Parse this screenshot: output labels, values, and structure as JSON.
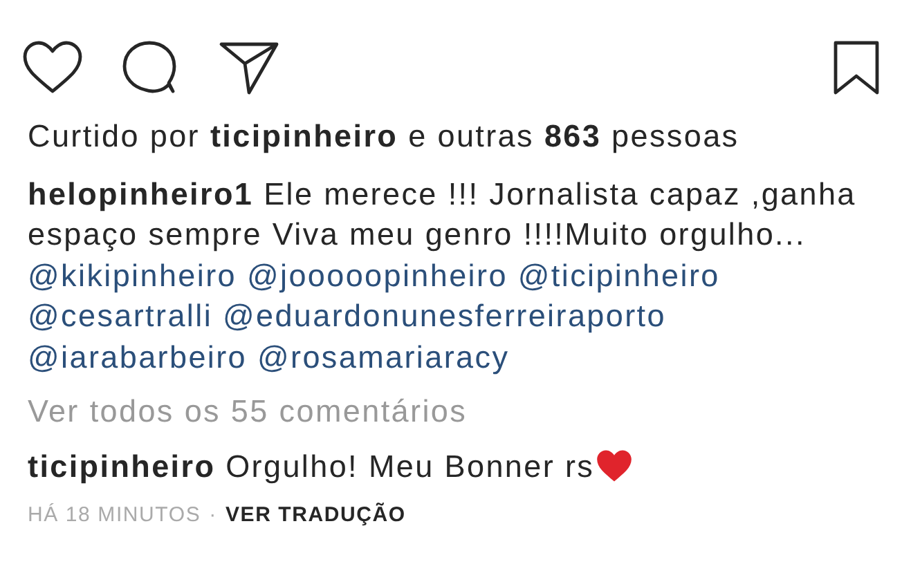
{
  "likes": {
    "text": "Curtido por **ticipinheiro** e outras **863** pessoas"
  },
  "caption": {
    "username": "helopinheiro1",
    "text": "Ele merece !!! Jornalista capaz ,ganha espaço sempre Viva meu genro !!!!Muito orgulho...",
    "mentions": [
      "@kikipinheiro",
      "@jooooopinheiro",
      "@ticipinheiro",
      "@cesartralli",
      "@eduardonunesferreiraporto",
      "@iarabarbeiro",
      "@rosamariaracy"
    ]
  },
  "view_comments": "Ver todos os 55 comentários",
  "comments": [
    {
      "username": "ticipinheiro",
      "text": "Orgulho! Meu Bonner rs"
    }
  ],
  "timestamp": "HÁ 18 MINUTOS",
  "separator": "·",
  "translate": "VER TRADUÇÃO",
  "saved": false
}
